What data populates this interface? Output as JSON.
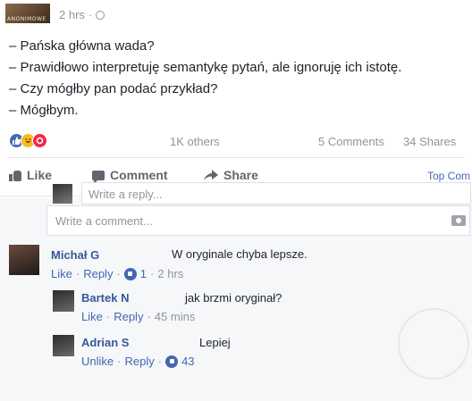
{
  "post": {
    "time": "2 hrs",
    "separator": "·",
    "lines": [
      "– Pańska główna wada?",
      "– Prawidłowo interpretuję semantykę pytań, ale ignoruję ich istotę.",
      "– Czy mógłby pan podać przykład?",
      "– Mógłbym."
    ],
    "others": "1K others",
    "comments": "5 Comments",
    "shares": "34 Shares"
  },
  "actions": {
    "like": "Like",
    "comment": "Comment",
    "share": "Share",
    "top_comments": "Top Com"
  },
  "write_comment_placeholder": "Write a comment...",
  "comments": [
    {
      "name": "Michał G",
      "text": "W oryginale chyba lepsze.",
      "like": "Like",
      "reply": "Reply",
      "likes": "1",
      "time": "2 hrs"
    },
    {
      "name": "Bartek N",
      "text": "jak brzmi oryginał?",
      "like": "Like",
      "reply": "Reply",
      "time": "45 mins"
    },
    {
      "name": "Adrian S",
      "text": "Lepiej",
      "like": "Unlike",
      "reply": "Reply",
      "likes": "43"
    }
  ],
  "write_reply_placeholder": "Write a reply...",
  "colors": {
    "link": "#365899",
    "action": "#4267b2",
    "muted": "#90949c",
    "like_reaction": "#4267b2",
    "haha_reaction": "#f7b928",
    "angry_reaction": "#f02849"
  }
}
